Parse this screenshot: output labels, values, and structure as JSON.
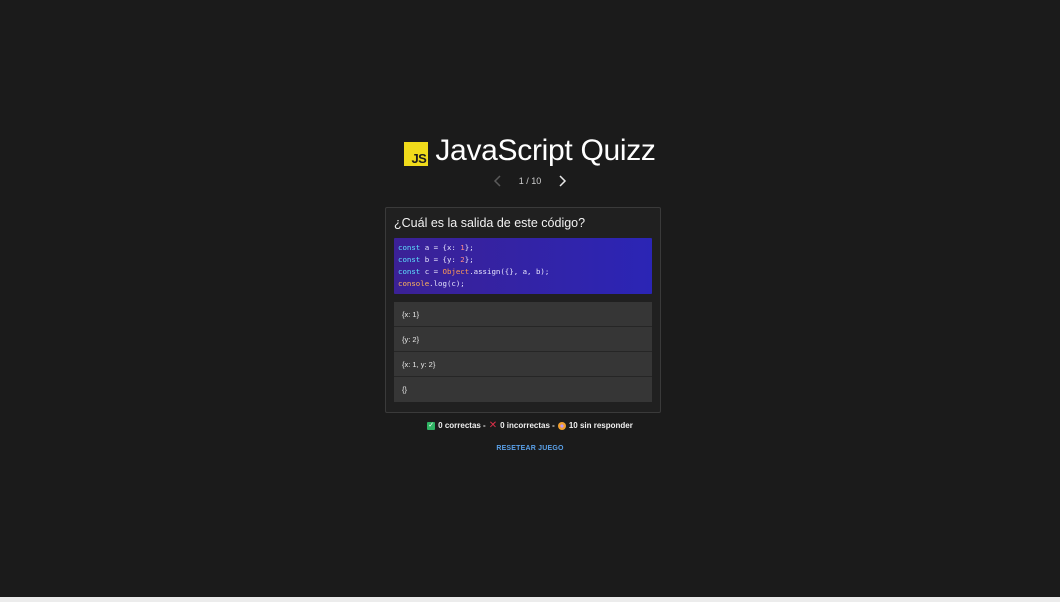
{
  "header": {
    "logo_text": "JS",
    "title": "JavaScript Quizz"
  },
  "pager": {
    "counter": "1 / 10"
  },
  "question": {
    "text": "¿Cuál es la salida de este código?",
    "code_lines": [
      "const a = {x: 1};",
      "const b = {y: 2};",
      "const c = Object.assign({}, a, b);",
      "console.log(c);"
    ],
    "options": [
      "{x: 1}",
      "{y: 2}",
      "{x: 1, y: 2}",
      "{}"
    ]
  },
  "score": {
    "correct": "0 correctas -",
    "incorrect": "0 incorrectas -",
    "unanswered": "10 sin responder"
  },
  "actions": {
    "reset": "RESETEAR JUEGO"
  },
  "colors": {
    "background": "#1b1b1b",
    "js_yellow": "#f0db1b",
    "code_bg_start": "#3b2196",
    "code_bg_end": "#2b25b5",
    "reset_link": "#5aa0e8"
  }
}
